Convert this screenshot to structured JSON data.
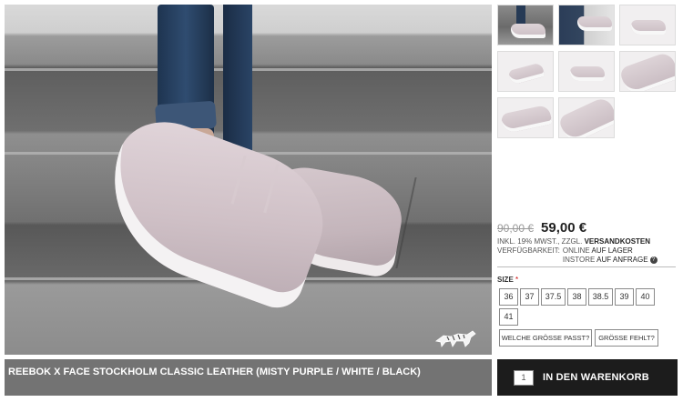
{
  "product": {
    "title": "REEBOK X FACE STOCKHOLM CLASSIC LEATHER (MISTY PURPLE / WHITE / BLACK)",
    "old_price": "90,00 €",
    "new_price": "59,00 €",
    "tax_text": "INKL. 19% MWST., ZZGL. ",
    "shipping_link": "VERSANDKOSTEN"
  },
  "availability": {
    "label": "VERFÜGBARKEIT:",
    "online_prefix": "ONLINE",
    "online_status": "AUF LAGER",
    "store_prefix": "INSTORE",
    "store_status": "AUF ANFRAGE"
  },
  "sizes": {
    "label": "SIZE",
    "required_mark": "*",
    "options": [
      "36",
      "37",
      "37.5",
      "38",
      "38.5",
      "39",
      "40",
      "41"
    ],
    "which_size_button": "WELCHE GRÖSSE PASST?",
    "missing_size_button": "GRÖSSE FEHLT?"
  },
  "cart": {
    "quantity": "1",
    "button_label": "IN DEN WARENKORB"
  },
  "thumbnails": [
    {
      "name": "thumbnail-1"
    },
    {
      "name": "thumbnail-2"
    },
    {
      "name": "thumbnail-3"
    },
    {
      "name": "thumbnail-4"
    },
    {
      "name": "thumbnail-5"
    },
    {
      "name": "thumbnail-6"
    },
    {
      "name": "thumbnail-7"
    },
    {
      "name": "thumbnail-8"
    }
  ],
  "colors": {
    "title_bar": "#737373",
    "cart_bar": "#1c1c1c",
    "help_icon": "#444444"
  }
}
